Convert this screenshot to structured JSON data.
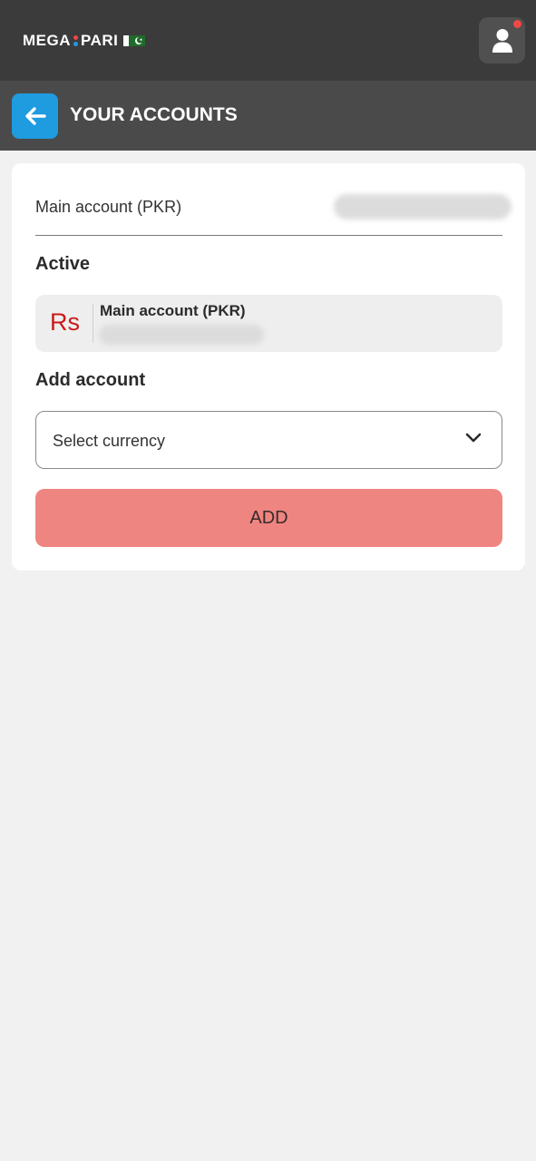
{
  "brand": {
    "logo_part1": "MEGA",
    "logo_part2": "PARI",
    "accent_dot_top": "#f04747",
    "accent_dot_bottom": "#1f9be0"
  },
  "header": {
    "title": "YOUR ACCOUNTS",
    "back_icon": "arrow-left-icon",
    "profile_icon": "user-icon",
    "notification_color": "#f04747"
  },
  "account": {
    "label": "Main account (PKR)",
    "balance_hidden": true
  },
  "active_section": {
    "title": "Active",
    "currency_symbol": "Rs",
    "account_name": "Main account (PKR)"
  },
  "add_section": {
    "title": "Add account",
    "select_placeholder": "Select currency",
    "add_button_label": "ADD"
  },
  "colors": {
    "topbar": "#3b3b3b",
    "headerbar": "#4a4a4a",
    "back_button": "#1f9be0",
    "add_button": "#ef8580",
    "currency_symbol": "#c91a1a"
  }
}
